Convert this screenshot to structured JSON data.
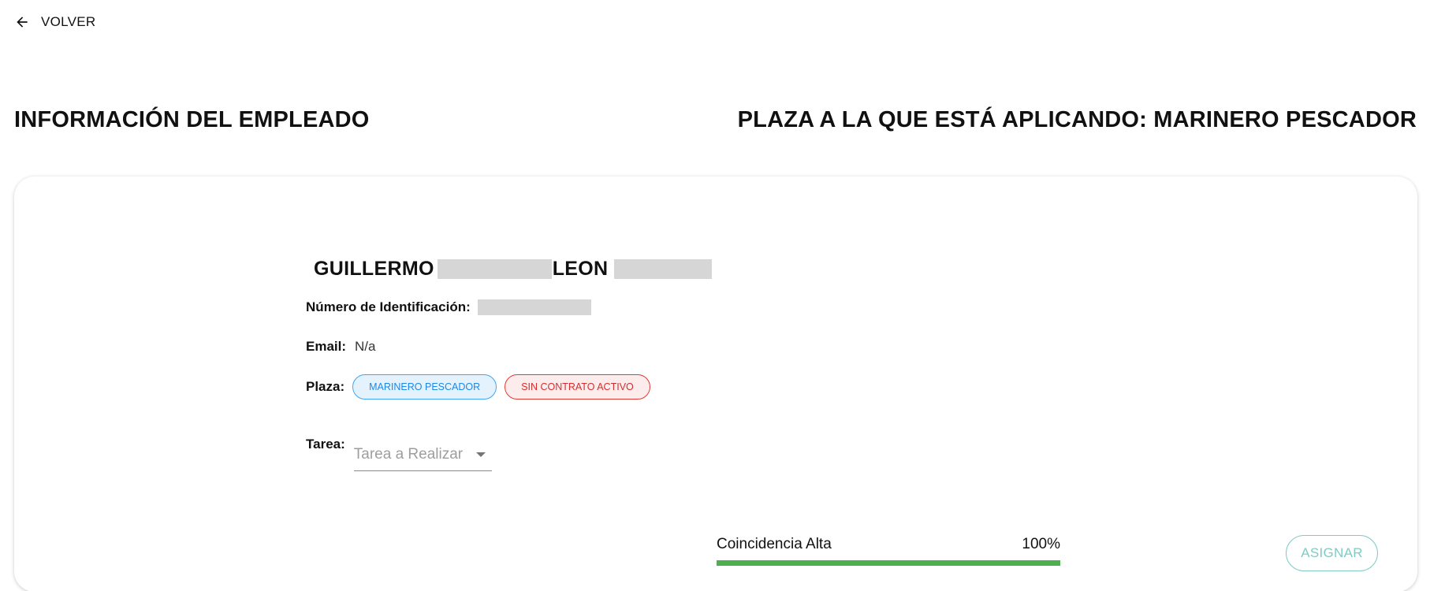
{
  "nav": {
    "back_label": "VOLVER"
  },
  "headings": {
    "employee_info": "INFORMACIÓN DEL EMPLEADO",
    "applying_position": "PLAZA A LA QUE ESTÁ APLICANDO: MARINERO PESCADOR"
  },
  "employee": {
    "first_name": "GUILLERMO",
    "last_name": "LEON",
    "id_label": "Número de Identificación:",
    "email_label": "Email:",
    "email_value": "N/a",
    "plaza_label": "Plaza:",
    "chips": [
      "MARINERO PESCADOR",
      "SIN CONTRATO ACTIVO"
    ],
    "tarea_label": "Tarea:",
    "tarea_placeholder": "Tarea a Realizar"
  },
  "match": {
    "label": "Coincidencia Alta",
    "percent_text": "100%",
    "percent_value": 100
  },
  "actions": {
    "assign_label": "ASIGNAR"
  },
  "colors": {
    "chip_blue": "#1e88e5",
    "chip_red": "#d32f2f",
    "progress": "#4caf50",
    "assign": "#80cbc4"
  }
}
